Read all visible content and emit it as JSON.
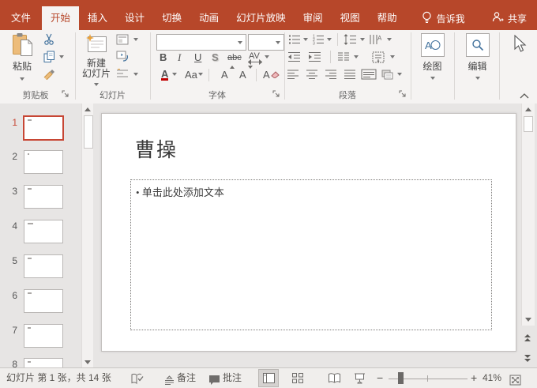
{
  "colors": {
    "accent": "#B7472A",
    "selected_thumb_border": "#C74634",
    "icon_blue": "#41719C",
    "clipboard_tan": "#EDBC7A",
    "star_orange": "#E9A13B"
  },
  "menubar": {
    "tabs": [
      {
        "label": "文件"
      },
      {
        "label": "开始",
        "selected": true
      },
      {
        "label": "插入"
      },
      {
        "label": "设计"
      },
      {
        "label": "切换"
      },
      {
        "label": "动画"
      },
      {
        "label": "幻灯片放映"
      },
      {
        "label": "审阅"
      },
      {
        "label": "视图"
      },
      {
        "label": "帮助"
      }
    ],
    "tell_me_label": "告诉我",
    "share_label": "共享"
  },
  "ribbon": {
    "paste_label": "粘贴",
    "clipboard_group_label": "剪贴板",
    "new_slide_line1": "新建",
    "new_slide_line2": "幻灯片",
    "slides_group_label": "幻灯片",
    "font_group_label": "字体",
    "font_controls": {
      "bold": "B",
      "italic": "I",
      "underline": "U",
      "shadow": "S",
      "strikethrough": "abc",
      "char_spacing": "AV",
      "font_color": "A",
      "change_case": "Aa",
      "grow_font": "A",
      "shrink_font": "A",
      "clear_format": "A"
    },
    "paragraph_group_label": "段落",
    "drawing_label": "绘图",
    "editing_label": "编辑"
  },
  "thumbnails": [
    {
      "number": "1",
      "selected": true
    },
    {
      "number": "2",
      "selected": false
    },
    {
      "number": "3",
      "selected": false
    },
    {
      "number": "4",
      "selected": false
    },
    {
      "number": "5",
      "selected": false
    },
    {
      "number": "6",
      "selected": false
    },
    {
      "number": "7",
      "selected": false
    },
    {
      "number": "8",
      "selected": false
    }
  ],
  "slide": {
    "title": "曹操",
    "bullet": "•",
    "body_placeholder": "单击此处添加文本"
  },
  "statusbar": {
    "slide_info": "幻灯片 第 1 张，共 14 张",
    "notes": "备注",
    "comments": "批注",
    "zoom": "41%",
    "zoom_out": "−",
    "zoom_in": "+"
  }
}
